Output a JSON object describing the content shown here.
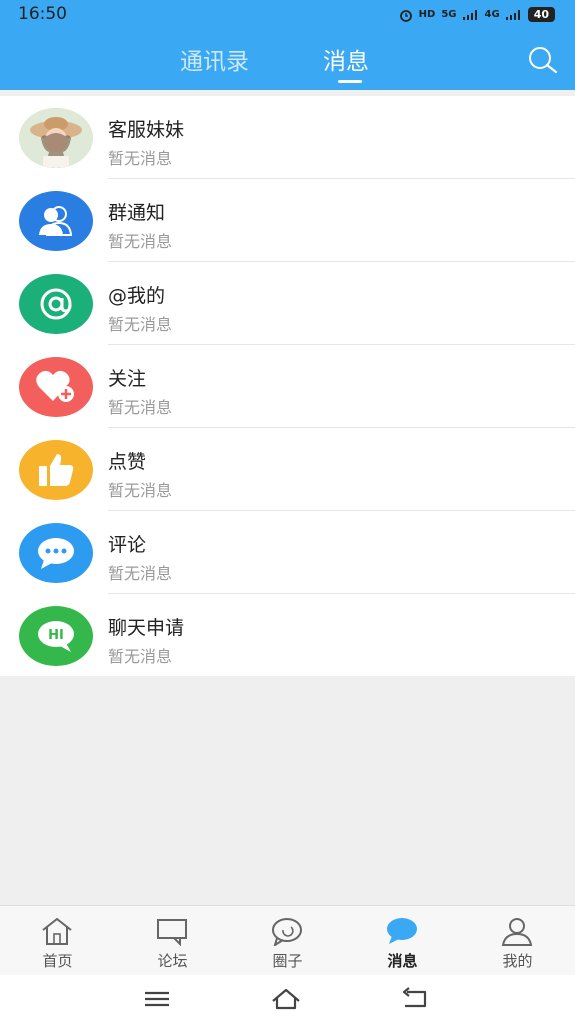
{
  "status_bar": {
    "time": "16:50",
    "indicators": [
      "alarm-icon",
      "HD",
      "5G",
      "4G"
    ],
    "battery": "40"
  },
  "header": {
    "tabs": [
      {
        "label": "通讯录",
        "active": false
      },
      {
        "label": "消息",
        "active": true
      }
    ],
    "search_icon": "search-icon",
    "accent_color": "#3aa8f2"
  },
  "messages": [
    {
      "title": "客服妹妹",
      "subtitle": "暂无消息",
      "icon": "avatar-photo",
      "color": "#e9d6c7"
    },
    {
      "title": "群通知",
      "subtitle": "暂无消息",
      "icon": "group-icon",
      "color": "#2a7de1"
    },
    {
      "title": "@我的",
      "subtitle": "暂无消息",
      "icon": "at-icon",
      "color": "#1bb07a"
    },
    {
      "title": "关注",
      "subtitle": "暂无消息",
      "icon": "heart-plus-icon",
      "color": "#f25f5c"
    },
    {
      "title": "点赞",
      "subtitle": "暂无消息",
      "icon": "thumbs-up-icon",
      "color": "#f6b32b"
    },
    {
      "title": "评论",
      "subtitle": "暂无消息",
      "icon": "comment-icon",
      "color": "#2d9cf0"
    },
    {
      "title": "聊天申请",
      "subtitle": "暂无消息",
      "icon": "hi-chat-icon",
      "color": "#35b84b"
    }
  ],
  "bottom_nav": [
    {
      "label": "首页",
      "icon": "home-icon",
      "active": false
    },
    {
      "label": "论坛",
      "icon": "forum-icon",
      "active": false
    },
    {
      "label": "圈子",
      "icon": "circle-icon",
      "active": false
    },
    {
      "label": "消息",
      "icon": "message-icon",
      "active": true
    },
    {
      "label": "我的",
      "icon": "profile-icon",
      "active": false
    }
  ],
  "system_nav": [
    "menu-icon",
    "home-icon",
    "back-icon"
  ]
}
